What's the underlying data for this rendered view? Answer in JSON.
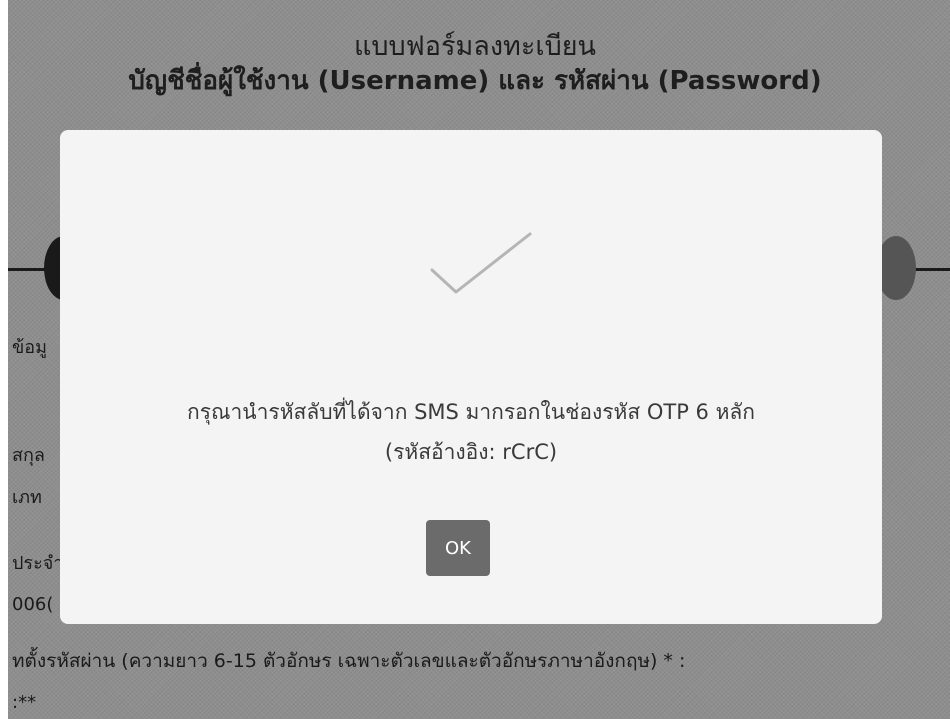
{
  "header": {
    "title_line1": "แบบฟอร์มลงทะเบียน",
    "title_line2": "บัญชีชื่อผู้ใช้งาน (Username) และ รหัสผ่าน (Password)"
  },
  "background_labels": {
    "a": "ข้อมู",
    "b": "สกุล",
    "c": "เภท",
    "d": "ประจำ",
    "e": "006(",
    "f": "ทตั้งรหัสผ่าน (ความยาว 6-15 ตัวอักษร เฉพาะตัวเลขและตัวอักษรภาษาอังกฤษ) * :",
    "g": ":**"
  },
  "dialog": {
    "icon": "checkmark-icon",
    "message_line1": "กรุณานำรหัสลับที่ได้จาก SMS มากรอกในช่องรหัส OTP 6 หลัก",
    "message_line2": "(รหัสอ้างอิง: rCrC)",
    "ok_label": "OK"
  },
  "colors": {
    "overlay": "#8e8e8e",
    "dialog_bg": "#f4f4f4",
    "ok_button": "#6b6b6b",
    "check_stroke": "#b5b5b5"
  }
}
